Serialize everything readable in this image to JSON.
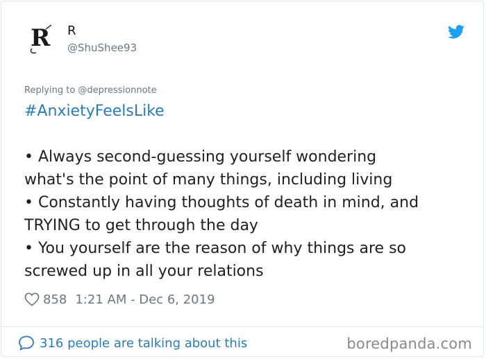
{
  "user": {
    "display_name": "R",
    "handle": "@ShuShee93",
    "avatar_glyph": "R"
  },
  "tweet": {
    "replying_to": "Replying to @depressionnote",
    "hashtag": "#AnxietyFeelsLike",
    "lines": [
      "• Always second-guessing yourself wondering",
      "what's the point of many things, including living",
      "• Constantly having thoughts of death in mind, and",
      "TRYING to get through the day",
      "• You yourself are the reason of why things are so",
      "screwed up in all your relations"
    ],
    "likes": "858",
    "timestamp": "1:21 AM - Dec 6, 2019"
  },
  "footer": {
    "talking_label": "316 people are talking about this",
    "watermark": "boredpanda.com"
  },
  "colors": {
    "link": "#2b7bb9",
    "muted": "#657786",
    "twitter_blue": "#1da1f2",
    "border": "#e1e8ed"
  },
  "icons": [
    "avatar-logo",
    "twitter-bird-icon",
    "heart-icon",
    "speech-bubble-icon"
  ]
}
